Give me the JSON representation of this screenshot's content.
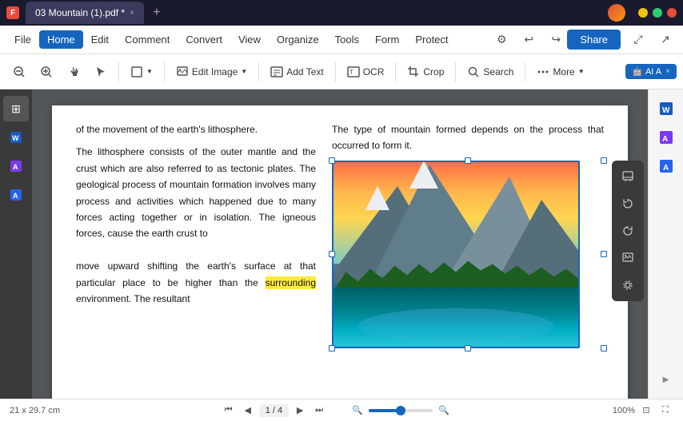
{
  "titlebar": {
    "tab_title": "03 Mountain (1).pdf *",
    "app_icon": "F",
    "close_label": "×",
    "new_tab_label": "+"
  },
  "menubar": {
    "file_label": "File",
    "tabs": [
      "Home",
      "Edit",
      "Comment",
      "Convert",
      "View",
      "Organize",
      "Tools",
      "Form",
      "Protect"
    ],
    "active_tab": "Home",
    "share_label": "Share",
    "tools_form_label": "Tools Form",
    "protect_label": "Protect",
    "search_label": "Search"
  },
  "toolbar": {
    "zoom_out_label": "−",
    "zoom_in_label": "+",
    "hand_label": "✋",
    "select_label": "▲",
    "shape_label": "□",
    "edit_image_label": "Edit Image",
    "add_text_label": "Add Text",
    "ocr_label": "OCR",
    "crop_label": "Crop",
    "search_label": "Search",
    "more_label": "More",
    "ai_label": "AI A"
  },
  "pdf": {
    "text_col1_top": "of the movement of the earth's lithosphere.",
    "text_col1_body": "The lithosphere consists of the outer mantle and the crust which are also referred to as tectonic plates. The geological process of mountain formation involves many process and activities which happened due to many forces acting together or in isolation. The igneous forces,  cause the earth crust to",
    "text_col1_bottom": "move upward shifting the earth's surface at that particular place to be higher than the surrounding environment. The resultant",
    "text_col2_top": "The type of mountain formed depends on the process that occurred to form it.",
    "highlighted_word": "surrounding"
  },
  "statusbar": {
    "dimensions": "21 x 29.7 cm",
    "page_info": "1 / 4",
    "zoom_percent": "100%"
  },
  "right_panel": {
    "icons": [
      "W",
      "A",
      "A"
    ]
  }
}
